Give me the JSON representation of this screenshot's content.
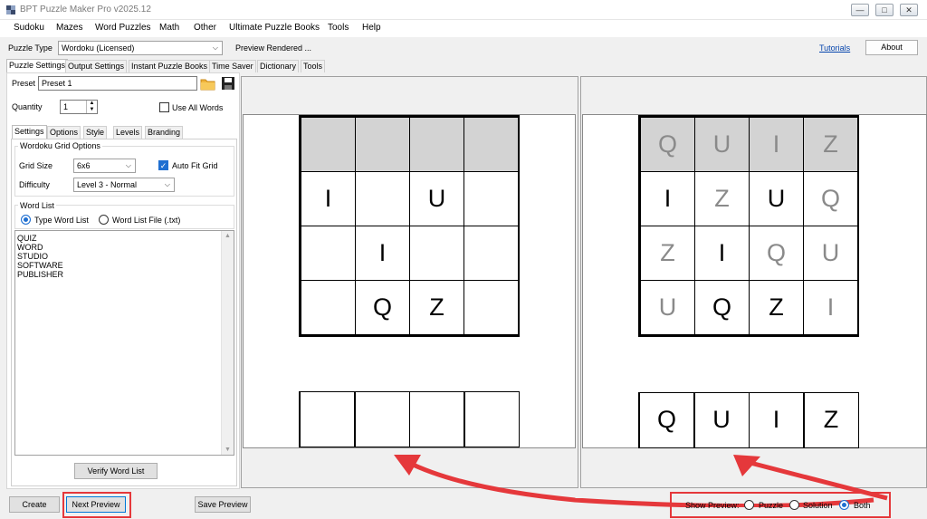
{
  "window": {
    "title": "BPT Puzzle Maker Pro v2025.12",
    "minimize": "—",
    "maximize": "□",
    "close": "✕"
  },
  "menu": [
    "Sudoku",
    "Mazes",
    "Word Puzzles",
    "Math",
    "Other",
    "Ultimate Puzzle Books",
    "Tools",
    "Help"
  ],
  "puzzle_type": {
    "label": "Puzzle Type",
    "value": "Wordoku (Licensed)",
    "status": "Preview Rendered ..."
  },
  "header_links": {
    "tutorials": "Tutorials",
    "about": "About"
  },
  "main_tabs": [
    "Puzzle Settings",
    "Output Settings",
    "Instant Puzzle Books",
    "Time Saver",
    "Dictionary",
    "Tools"
  ],
  "preset": {
    "label": "Preset",
    "value": "Preset 1"
  },
  "quantity": {
    "label": "Quantity",
    "value": "1"
  },
  "use_all_words": "Use All Words",
  "sub_tabs": [
    "Settings",
    "Options",
    "Style",
    "Levels",
    "Branding"
  ],
  "grid_options": {
    "title": "Wordoku Grid Options",
    "grid_size_label": "Grid Size",
    "grid_size": "6x6",
    "auto_fit": "Auto Fit Grid",
    "difficulty_label": "Difficulty",
    "difficulty": "Level 3 - Normal"
  },
  "word_list": {
    "title": "Word List",
    "type_option": "Type Word List",
    "file_option": "Word List File (.txt)",
    "words": [
      "QUIZ",
      "WORD",
      "STUDIO",
      "SOFTWARE",
      "PUBLISHER"
    ],
    "verify": "Verify Word List"
  },
  "puzzle_preview": {
    "header": [
      "",
      "",
      "",
      ""
    ],
    "rows": [
      [
        "I",
        "",
        "U",
        ""
      ],
      [
        "",
        "I",
        "",
        ""
      ],
      [
        "",
        "Q",
        "Z",
        ""
      ]
    ],
    "answer": [
      "",
      "",
      "",
      ""
    ]
  },
  "solution_preview": {
    "header": [
      "Q",
      "U",
      "I",
      "Z"
    ],
    "rows": [
      [
        {
          "t": "I",
          "g": true
        },
        {
          "t": "Z",
          "g": false
        },
        {
          "t": "U",
          "g": true
        },
        {
          "t": "Q",
          "g": false
        }
      ],
      [
        {
          "t": "Z",
          "g": false
        },
        {
          "t": "I",
          "g": true
        },
        {
          "t": "Q",
          "g": false
        },
        {
          "t": "U",
          "g": false
        }
      ],
      [
        {
          "t": "U",
          "g": false
        },
        {
          "t": "Q",
          "g": true
        },
        {
          "t": "Z",
          "g": true
        },
        {
          "t": "I",
          "g": false
        }
      ]
    ],
    "answer": [
      "Q",
      "U",
      "I",
      "Z"
    ]
  },
  "bottom": {
    "create": "Create",
    "next_preview": "Next Preview",
    "save_preview": "Save Preview",
    "show_preview_label": "Show Preview:",
    "options": [
      "Puzzle",
      "Solution",
      "Both"
    ],
    "selected": "Both"
  },
  "colors": {
    "accent": "#1f6fd1",
    "highlight": "#e5383b",
    "header_cell": "#d3d3d3",
    "solution_text": "#8a8a8a"
  },
  "icons": {
    "folder": "folder-icon",
    "save": "floppy-disk-icon",
    "app": "puzzle-app-icon"
  }
}
